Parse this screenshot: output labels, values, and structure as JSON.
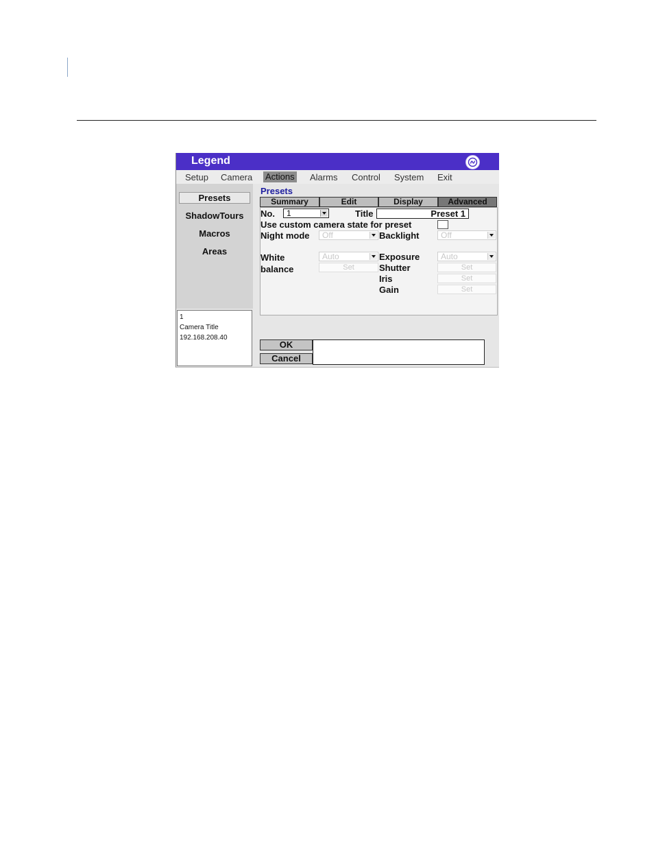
{
  "app": {
    "title": "Legend"
  },
  "menu": [
    "Setup",
    "Camera",
    "Actions",
    "Alarms",
    "Control",
    "System",
    "Exit"
  ],
  "sidebar": {
    "items": [
      "Presets",
      "ShadowTours",
      "Macros",
      "Areas"
    ]
  },
  "camera_info": {
    "number": "1",
    "title": "Camera Title",
    "ip": "192.168.208.40"
  },
  "content": {
    "title": "Presets",
    "tabs": [
      "Summary",
      "Edit",
      "Display",
      "Advanced"
    ],
    "fields": {
      "no_label": "No.",
      "no_value": "1",
      "title_label": "Title",
      "title_value": "Preset 1",
      "custom_state_label": "Use custom camera state for preset",
      "night_mode_label": "Night mode",
      "night_mode_value": "Off",
      "backlight_label": "Backlight",
      "backlight_value": "Off",
      "white_label": "White",
      "balance_label": "balance",
      "white_balance_value": "Auto",
      "white_balance_set": "Set",
      "exposure_label": "Exposure",
      "exposure_value": "Auto",
      "shutter_label": "Shutter",
      "shutter_set": "Set",
      "iris_label": "Iris",
      "iris_set": "Set",
      "gain_label": "Gain",
      "gain_set": "Set"
    }
  },
  "buttons": {
    "ok": "OK",
    "cancel": "Cancel"
  }
}
